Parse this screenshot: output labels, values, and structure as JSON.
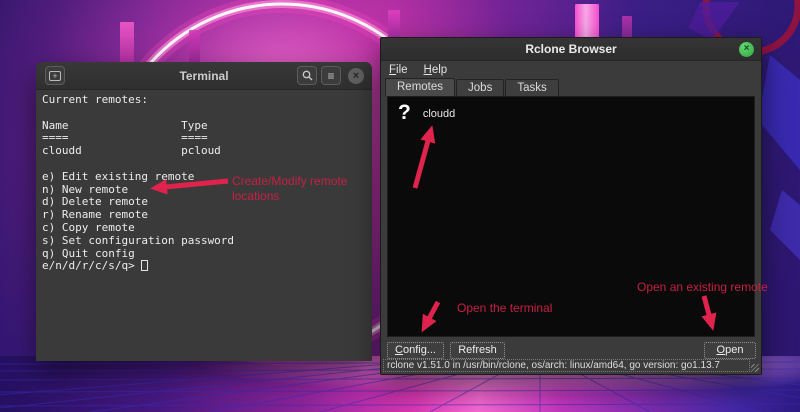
{
  "colors": {
    "annotation_arrow": "#e0234c",
    "annotation_text": "#c52044",
    "close_button_green": "#3cbc4c",
    "terminal_bg": "#3a3a3a",
    "list_bg": "#0a0a0a"
  },
  "terminal": {
    "title": "Terminal",
    "new_tab_icon": "+",
    "menu_icon": "≡",
    "close_icon": "×",
    "lines": [
      "Current remotes:",
      "",
      "Name                 Type",
      "====                 ====",
      "cloudd               pcloud",
      "",
      "e) Edit existing remote",
      "n) New remote",
      "d) Delete remote",
      "r) Rename remote",
      "c) Copy remote",
      "s) Set configuration password",
      "q) Quit config"
    ],
    "prompt": "e/n/d/r/c/s/q> "
  },
  "rclone": {
    "title": "Rclone Browser",
    "close_icon": "×",
    "menu": {
      "file": "File",
      "help": "Help"
    },
    "tabs": {
      "remotes": "Remotes",
      "jobs": "Jobs",
      "tasks": "Tasks"
    },
    "remote": {
      "icon": "?",
      "name": "cloudd"
    },
    "buttons": {
      "config": "Config...",
      "refresh": "Refresh",
      "open": "Open"
    },
    "status": "rclone v1.51.0 in /usr/bin/rclone, os/arch: linux/amd64, go version: go1.13.7"
  },
  "annotations": {
    "create_modify_label": "Create/Modify remote locations",
    "open_terminal_label": "Open the terminal",
    "open_existing_label": "Open an existing remote"
  }
}
